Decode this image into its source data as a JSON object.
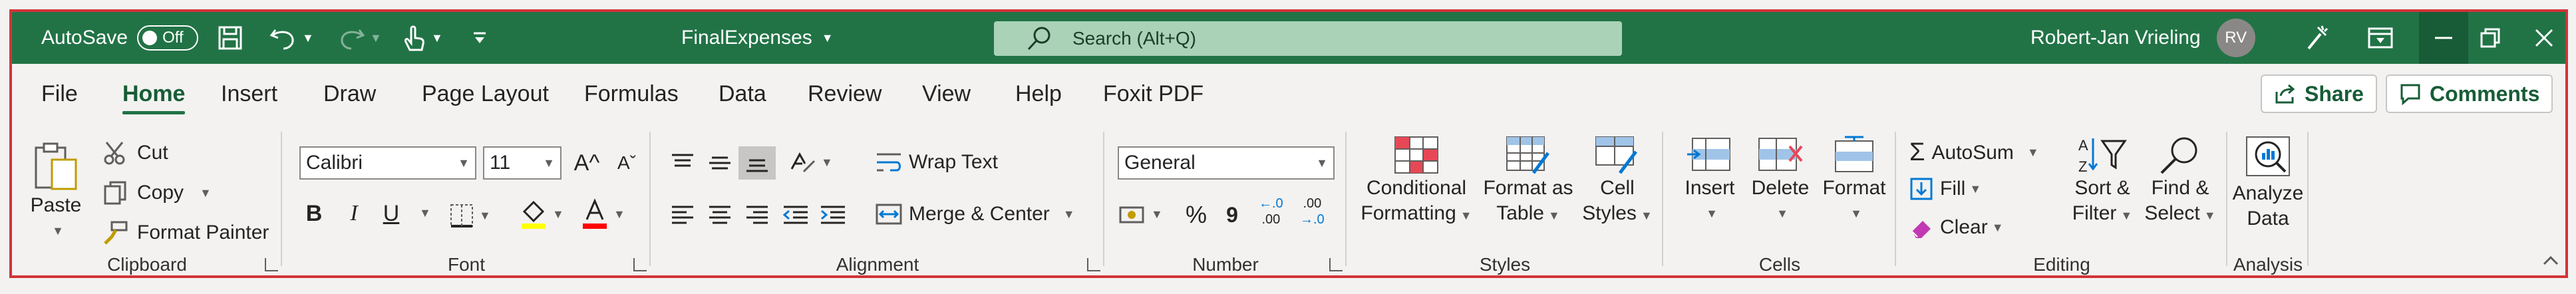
{
  "titlebar": {
    "autosave_label": "AutoSave",
    "autosave_state": "Off",
    "filename": "FinalExpenses",
    "search_placeholder": "Search (Alt+Q)",
    "user_name": "Robert-Jan Vrieling",
    "user_initials": "RV"
  },
  "tabs": [
    "File",
    "Home",
    "Insert",
    "Draw",
    "Page Layout",
    "Formulas",
    "Data",
    "Review",
    "View",
    "Help",
    "Foxit PDF"
  ],
  "active_tab": "Home",
  "share_label": "Share",
  "comments_label": "Comments",
  "clipboard": {
    "paste": "Paste",
    "cut": "Cut",
    "copy": "Copy",
    "format_painter": "Format Painter",
    "label": "Clipboard"
  },
  "font": {
    "name": "Calibri",
    "size": "11",
    "grow": "A^",
    "shrink": "Aˇ",
    "bold": "B",
    "italic": "I",
    "underline": "U",
    "label": "Font"
  },
  "alignment": {
    "wrap_text": "Wrap Text",
    "merge_center": "Merge & Center",
    "label": "Alignment"
  },
  "number": {
    "format": "General",
    "percent": "%",
    "comma": "9",
    "inc_dec_top": "←.0",
    "inc_dec_bottom": ".00",
    "dec_dec_top": ".00",
    "dec_dec_bottom": "→.0",
    "label": "Number"
  },
  "styles": {
    "conditional_1": "Conditional",
    "conditional_2": "Formatting",
    "format_table_1": "Format as",
    "format_table_2": "Table",
    "cell_styles_1": "Cell",
    "cell_styles_2": "Styles",
    "label": "Styles"
  },
  "cells": {
    "insert": "Insert",
    "delete": "Delete",
    "format": "Format",
    "label": "Cells"
  },
  "editing": {
    "autosum": "AutoSum",
    "fill": "Fill",
    "clear": "Clear",
    "sort_1": "Sort &",
    "sort_2": "Filter",
    "find_1": "Find &",
    "find_2": "Select",
    "label": "Editing"
  },
  "analysis": {
    "analyze_1": "Analyze",
    "analyze_2": "Data",
    "label": "Analysis"
  },
  "colors": {
    "title_bar": "#217346",
    "search_box": "#a9d2b7",
    "active_tab": "#185c37",
    "frame_outline": "#d13438",
    "fill_color_bar": "#ffff00",
    "font_color_bar": "#ff0000"
  }
}
